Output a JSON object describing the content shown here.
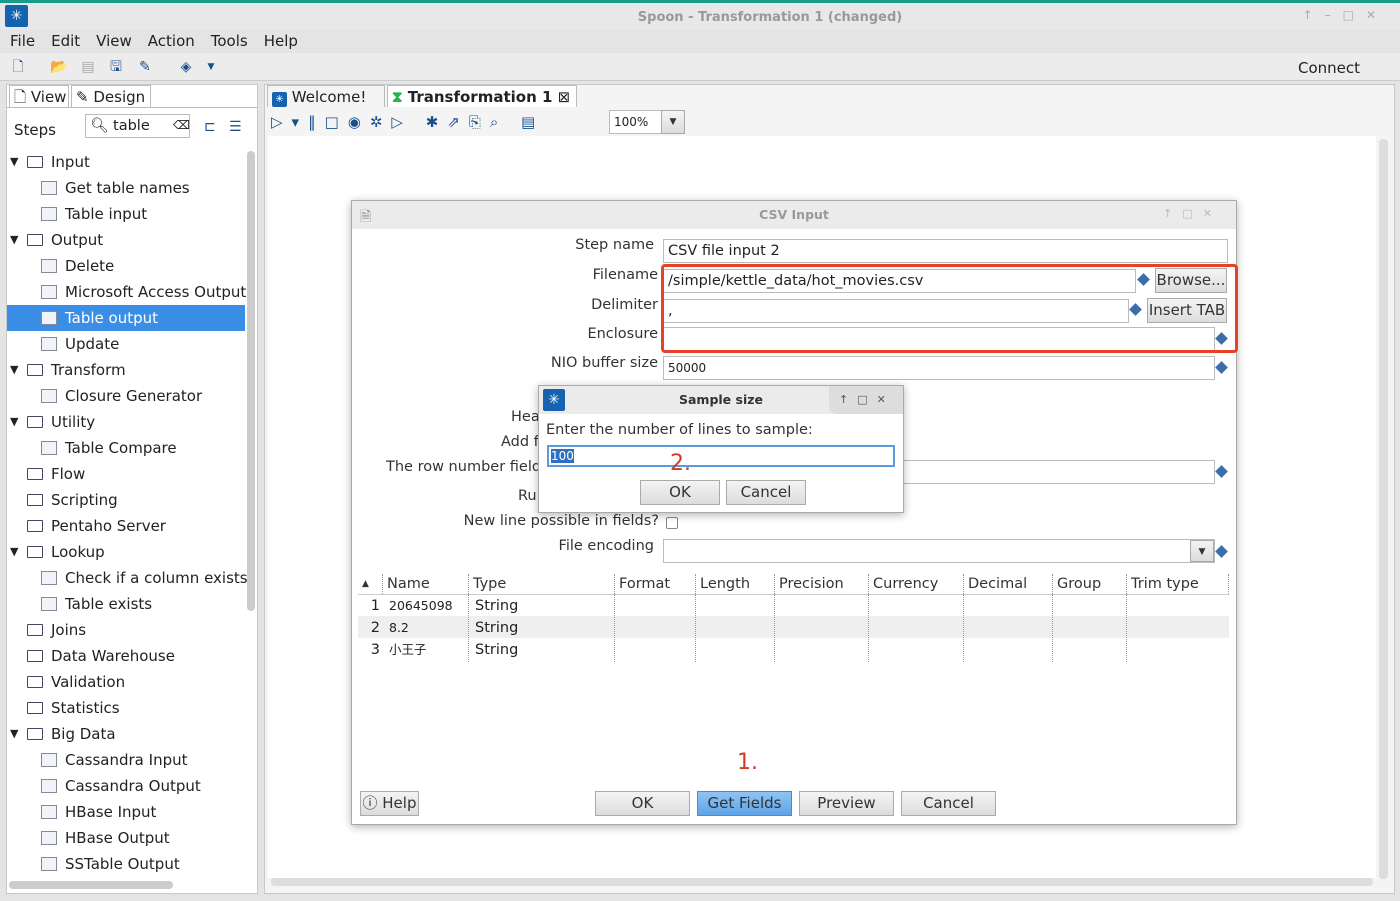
{
  "window": {
    "title": "Spoon - Transformation 1 (changed)"
  },
  "menu": [
    "File",
    "Edit",
    "View",
    "Action",
    "Tools",
    "Help"
  ],
  "toolbar": {
    "connect": "Connect"
  },
  "left_panel": {
    "tab_view": "View",
    "tab_design": "Design",
    "steps_label": "Steps",
    "search_value": "table",
    "tree": [
      {
        "label": "Input",
        "type": "folder",
        "open": true
      },
      {
        "label": "Get table names",
        "type": "leaf"
      },
      {
        "label": "Table input",
        "type": "leaf"
      },
      {
        "label": "Output",
        "type": "folder",
        "open": true
      },
      {
        "label": "Delete",
        "type": "leaf"
      },
      {
        "label": "Microsoft Access Output",
        "type": "leaf"
      },
      {
        "label": "Table output",
        "type": "leaf",
        "selected": true
      },
      {
        "label": "Update",
        "type": "leaf"
      },
      {
        "label": "Transform",
        "type": "folder",
        "open": true
      },
      {
        "label": "Closure Generator",
        "type": "leaf"
      },
      {
        "label": "Utility",
        "type": "folder",
        "open": true
      },
      {
        "label": "Table Compare",
        "type": "leaf"
      },
      {
        "label": "Flow",
        "type": "folder"
      },
      {
        "label": "Scripting",
        "type": "folder"
      },
      {
        "label": "Pentaho Server",
        "type": "folder"
      },
      {
        "label": "Lookup",
        "type": "folder",
        "open": true
      },
      {
        "label": "Check if a column exists",
        "type": "leaf"
      },
      {
        "label": "Table exists",
        "type": "leaf"
      },
      {
        "label": "Joins",
        "type": "folder"
      },
      {
        "label": "Data Warehouse",
        "type": "folder"
      },
      {
        "label": "Validation",
        "type": "folder"
      },
      {
        "label": "Statistics",
        "type": "folder"
      },
      {
        "label": "Big Data",
        "type": "folder",
        "open": true
      },
      {
        "label": "Cassandra Input",
        "type": "leaf"
      },
      {
        "label": "Cassandra Output",
        "type": "leaf"
      },
      {
        "label": "HBase Input",
        "type": "leaf"
      },
      {
        "label": "HBase Output",
        "type": "leaf"
      },
      {
        "label": "SSTable Output",
        "type": "leaf"
      }
    ]
  },
  "editor": {
    "tab_welcome": "Welcome!",
    "tab_transformation": "Transformation 1",
    "zoom": "100%"
  },
  "csv_dialog": {
    "title": "CSV Input",
    "labels": {
      "step_name": "Step name",
      "filename": "Filename",
      "delimiter": "Delimiter",
      "enclosure": "Enclosure",
      "nio": "NIO buffer size",
      "header": "Hea",
      "add": "Add f",
      "rownum": "The row number field",
      "run": "Ru",
      "newline": "New line possible in fields?",
      "encoding": "File encoding"
    },
    "values": {
      "step_name": "CSV file input 2",
      "filename": "/simple/kettle_data/hot_movies.csv",
      "delimiter": ",",
      "enclosure": "",
      "nio": "50000",
      "encoding": ""
    },
    "browse": "Browse...",
    "insert_tab": "Insert TAB",
    "columns": [
      "Name",
      "Type",
      "Format",
      "Length",
      "Precision",
      "Currency",
      "Decimal",
      "Group",
      "Trim type"
    ],
    "rows": [
      [
        "1",
        "20645098",
        "String"
      ],
      [
        "2",
        "8.2",
        "String"
      ],
      [
        "3",
        "小王子",
        "String"
      ]
    ],
    "buttons": {
      "help": "Help",
      "ok": "OK",
      "get_fields": "Get Fields",
      "preview": "Preview",
      "cancel": "Cancel"
    },
    "annotation_1": "1.",
    "highlight_color": "#e8412a"
  },
  "sample_dialog": {
    "title": "Sample size",
    "prompt": "Enter the number of lines to sample:",
    "value": "100",
    "ok": "OK",
    "cancel": "Cancel",
    "annotation_2": "2."
  }
}
